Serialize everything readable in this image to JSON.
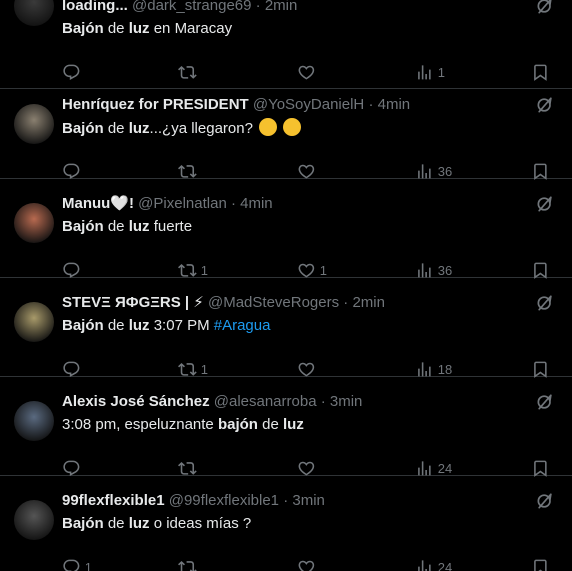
{
  "tweets": [
    {
      "name": "loading...",
      "handle": "@dark_strange69",
      "time": "2min",
      "text_html": "<b>Bajón</b> de <b>luz</b> en Maracay",
      "replies": "",
      "retweets": "",
      "likes": "",
      "views": "1",
      "avatar_color": "#3a3a3a"
    },
    {
      "name": "Henríquez for PRESIDENT",
      "handle": "@YoSoyDanielH",
      "time": "4min",
      "text_html": "<b>Bajón</b> de <b>luz</b>...¿ya llegaron?",
      "emojis": [
        "thinking-face",
        "grimacing-face"
      ],
      "replies": "",
      "retweets": "",
      "likes": "",
      "views": "36",
      "avatar_color": "#8a8070"
    },
    {
      "name": "Manuu🤍!",
      "handle": "@Pixelnatlan",
      "time": "4min",
      "text_html": "<b>Bajón</b> de <b>luz</b> fuerte",
      "replies": "",
      "retweets": "1",
      "likes": "1",
      "views": "36",
      "avatar_color": "#b86a50"
    },
    {
      "name": "STEVΞ ЯФGΞRS | ⚡",
      "handle": "@MadSteveRogers",
      "time": "2min",
      "text_html": "<b>Bajón</b> de <b>luz</b> 3:07 PM <span class=\"hashtag\">#Aragua</span>",
      "replies": "",
      "retweets": "1",
      "likes": "",
      "views": "18",
      "avatar_color": "#a89a6a"
    },
    {
      "name": "Alexis José Sánchez",
      "handle": "@alesanarroba",
      "time": "3min",
      "text_html": "3:08 pm, espeluznante <b>bajón</b> de <b>luz</b>",
      "replies": "",
      "retweets": "",
      "likes": "",
      "views": "24",
      "avatar_color": "#5a6a80"
    },
    {
      "name": "99flexflexible1",
      "handle": "@99flexflexible1",
      "time": "3min",
      "text_html": "<b>Bajón</b> de <b>luz</b> o ideas mías ?",
      "replies": "1",
      "retweets": "",
      "likes": "",
      "views": "24",
      "avatar_color": "#555555"
    }
  ],
  "separator": "·",
  "colors": {
    "background": "#000000",
    "text": "#e7e9ea",
    "muted": "#71767b",
    "accent": "#1d9bf0",
    "border": "#2f3336"
  }
}
